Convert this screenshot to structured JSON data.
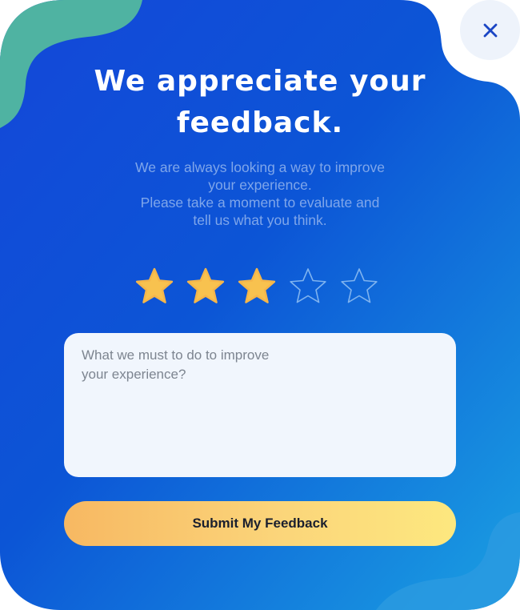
{
  "popup": {
    "title_line1": "We appreciate your",
    "title_line2": "feedback.",
    "subtitle_lines": [
      "We are always looking a way to improve",
      "your experience.",
      "Please take a moment to evaluate and",
      "tell us what you think."
    ],
    "rating": {
      "value": 3,
      "max": 5
    },
    "feedback_placeholder": "What we must to do to improve your experience?",
    "submit_label": "Submit My Feedback",
    "close_icon": "close-icon"
  },
  "colors": {
    "card_gradient_start": "#0d3fd8",
    "card_gradient_end": "#1a9be0",
    "accent_teal": "#4fb3a2",
    "star_filled": "#f8c24f",
    "star_outline": "#7fb3ef",
    "button_start": "#f7b862",
    "button_end": "#fde87f",
    "close_icon_color": "#1a45c4"
  }
}
